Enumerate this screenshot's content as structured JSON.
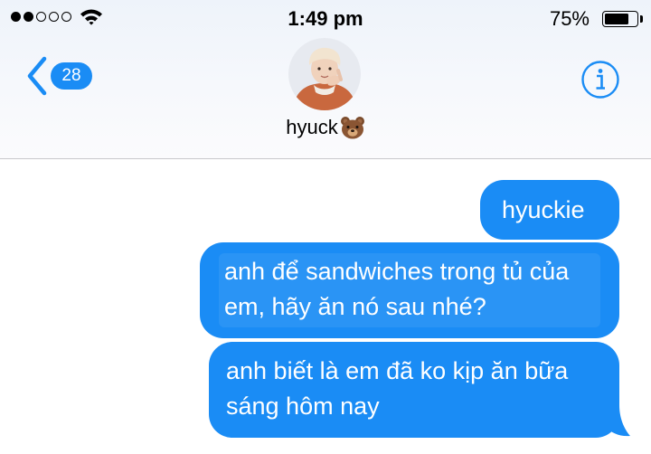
{
  "status_bar": {
    "signal": {
      "filled": 2,
      "total": 5
    },
    "time": "1:49 pm",
    "battery_percent": "75%",
    "battery_level": 0.75
  },
  "header": {
    "back_badge": "28",
    "contact_name": "hyuck",
    "contact_emoji": "bear-emoji"
  },
  "messages": [
    {
      "sender": "me",
      "text": "hyuckie"
    },
    {
      "sender": "me",
      "lines": [
        "anh để sandwiches trong tủ của",
        "em, hãy ăn nó sau nhé?"
      ]
    },
    {
      "sender": "me",
      "lines": [
        "anh biết là em đã ko kịp ăn bữa",
        "sáng hôm nay"
      ]
    }
  ],
  "colors": {
    "accent": "#1a8cf5",
    "bubble_text": "#ffffff",
    "header_bg": "#f4f7fb"
  },
  "icons": {
    "back": "chevron-left-icon",
    "info": "info-circle-icon",
    "wifi": "wifi-icon",
    "battery": "battery-icon"
  }
}
